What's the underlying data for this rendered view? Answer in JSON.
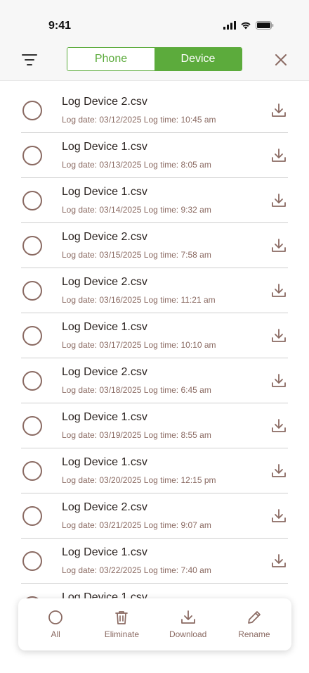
{
  "status_bar": {
    "time": "9:41"
  },
  "header": {
    "tabs": [
      {
        "label": "Phone",
        "active": false
      },
      {
        "label": "Device",
        "active": true
      }
    ],
    "accent_color": "#5cab3c"
  },
  "files": [
    {
      "name": "Log Device 2.csv",
      "meta": "Log date: 03/12/2025 Log time: 10:45 am"
    },
    {
      "name": "Log Device 1.csv",
      "meta": "Log date: 03/13/2025 Log time: 8:05 am"
    },
    {
      "name": "Log Device 1.csv",
      "meta": "Log date: 03/14/2025 Log time: 9:32 am"
    },
    {
      "name": "Log Device 2.csv",
      "meta": "Log date: 03/15/2025 Log time: 7:58 am"
    },
    {
      "name": "Log Device 2.csv",
      "meta": "Log date: 03/16/2025 Log time: 11:21 am"
    },
    {
      "name": "Log Device 1.csv",
      "meta": "Log date: 03/17/2025 Log time: 10:10 am"
    },
    {
      "name": "Log Device 2.csv",
      "meta": "Log date: 03/18/2025 Log time: 6:45 am"
    },
    {
      "name": "Log Device 1.csv",
      "meta": "Log date: 03/19/2025 Log time: 8:55 am"
    },
    {
      "name": "Log Device 1.csv",
      "meta": "Log date: 03/20/2025 Log time: 12:15 pm"
    },
    {
      "name": "Log Device 2.csv",
      "meta": "Log date: 03/21/2025 Log time: 9:07 am"
    },
    {
      "name": "Log Device 1.csv",
      "meta": "Log date: 03/22/2025 Log time: 7:40 am"
    },
    {
      "name": "Log Device 1.csv",
      "meta": ""
    }
  ],
  "toolbar": {
    "all_label": "All",
    "eliminate_label": "Eliminate",
    "download_label": "Download",
    "rename_label": "Rename"
  }
}
